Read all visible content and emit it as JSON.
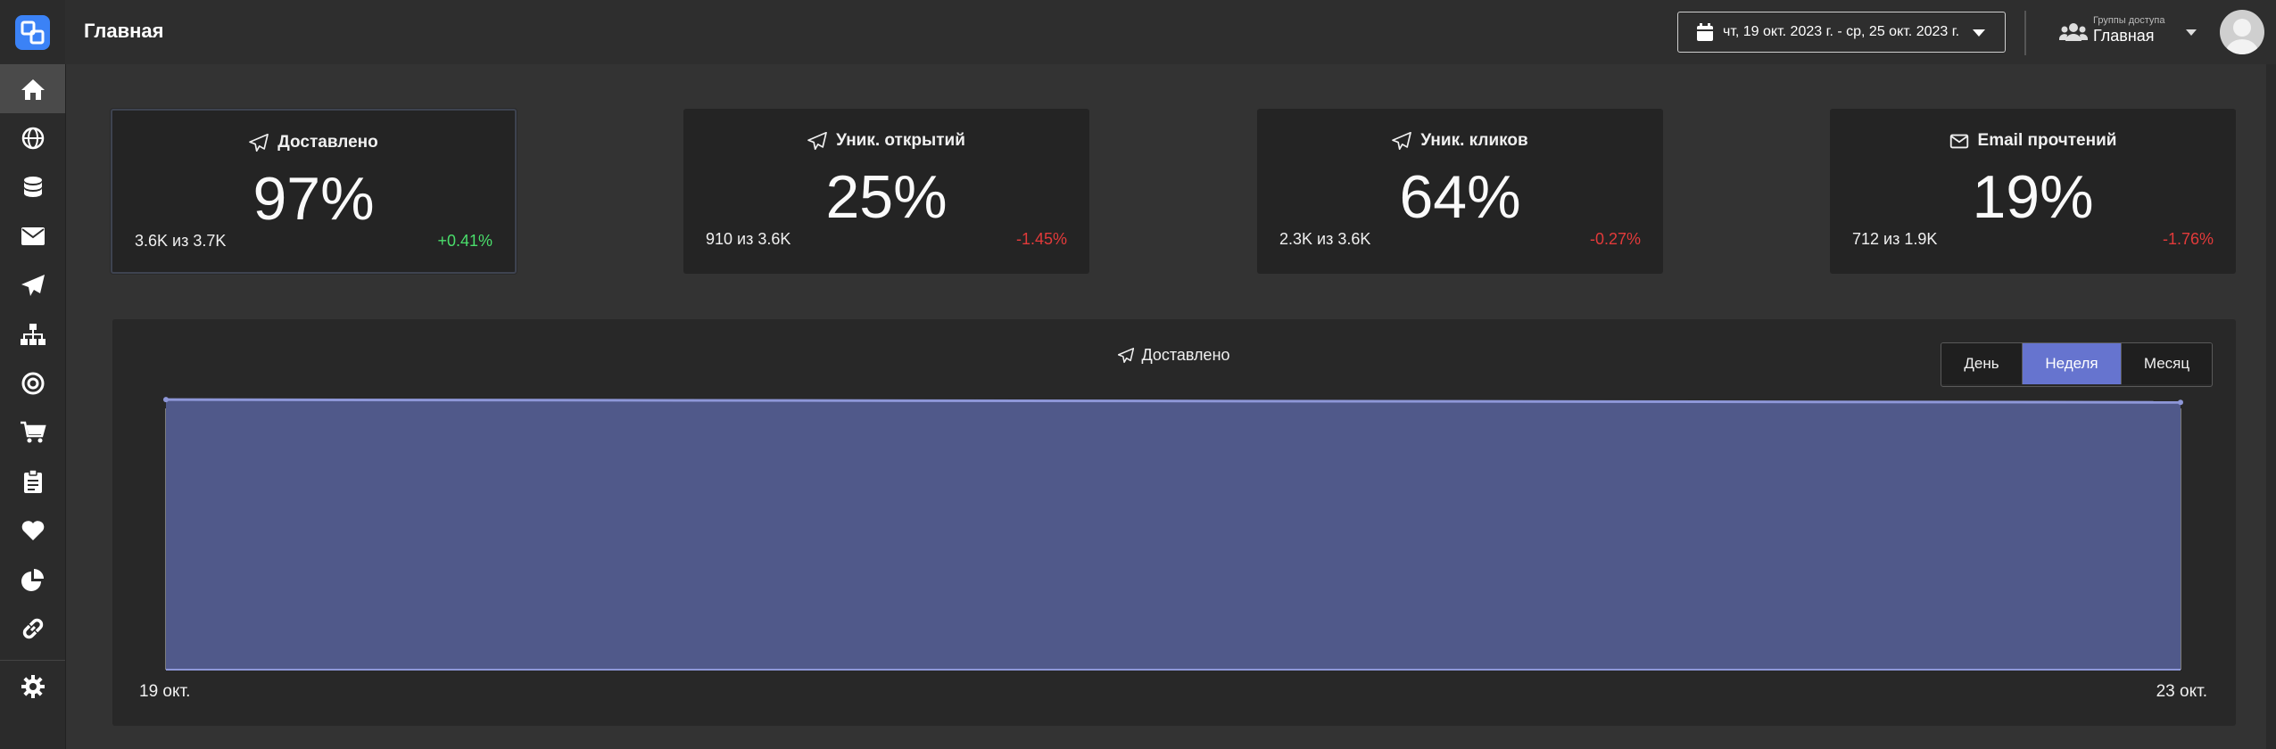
{
  "header": {
    "title": "Главная",
    "date_range": "чт, 19 окт. 2023 г. - ср, 25 окт. 2023 г.",
    "group_label": "Группы доступа",
    "group_value": "Главная"
  },
  "sidebar": {
    "items": [
      {
        "icon": "home-icon",
        "active": true
      },
      {
        "icon": "globe-icon"
      },
      {
        "icon": "database-icon"
      },
      {
        "icon": "envelope-icon"
      },
      {
        "icon": "paper-plane-icon"
      },
      {
        "icon": "sitemap-icon"
      },
      {
        "icon": "target-icon"
      },
      {
        "icon": "cart-icon"
      },
      {
        "icon": "clipboard-icon"
      },
      {
        "icon": "heart-icon"
      },
      {
        "icon": "pie-chart-icon"
      },
      {
        "icon": "link-icon"
      },
      {
        "icon": "gear-icon"
      }
    ]
  },
  "cards": [
    {
      "title": "Доставлено",
      "icon": "paper-plane-icon",
      "value": "97%",
      "sub": "3.6K из 3.7K",
      "delta": "+0.41%",
      "delta_color": "#4ade6b"
    },
    {
      "title": "Уник. открытий",
      "icon": "paper-plane-icon",
      "value": "25%",
      "sub": "910 из 3.6K",
      "delta": "-1.45%",
      "delta_color": "#e23a3a"
    },
    {
      "title": "Уник. кликов",
      "icon": "paper-plane-icon",
      "value": "64%",
      "sub": "2.3K из 3.6K",
      "delta": "-0.27%",
      "delta_color": "#e23a3a"
    },
    {
      "title": "Email прочтений",
      "icon": "envelope-icon",
      "value": "19%",
      "sub": "712 из 1.9K",
      "delta": "-1.76%",
      "delta_color": "#e23a3a"
    }
  ],
  "period": {
    "options": [
      "День",
      "Неделя",
      "Месяц"
    ],
    "selected": "Неделя"
  },
  "chart_data": {
    "type": "area",
    "title": "Доставлено",
    "x": [
      "19 окт.",
      "23 окт."
    ],
    "series": [
      {
        "values": [
          98,
          97
        ]
      }
    ],
    "ylim": [
      0,
      100
    ],
    "grid": false,
    "colors": {
      "fill": "#50598a",
      "line": "#8e97d8"
    }
  }
}
